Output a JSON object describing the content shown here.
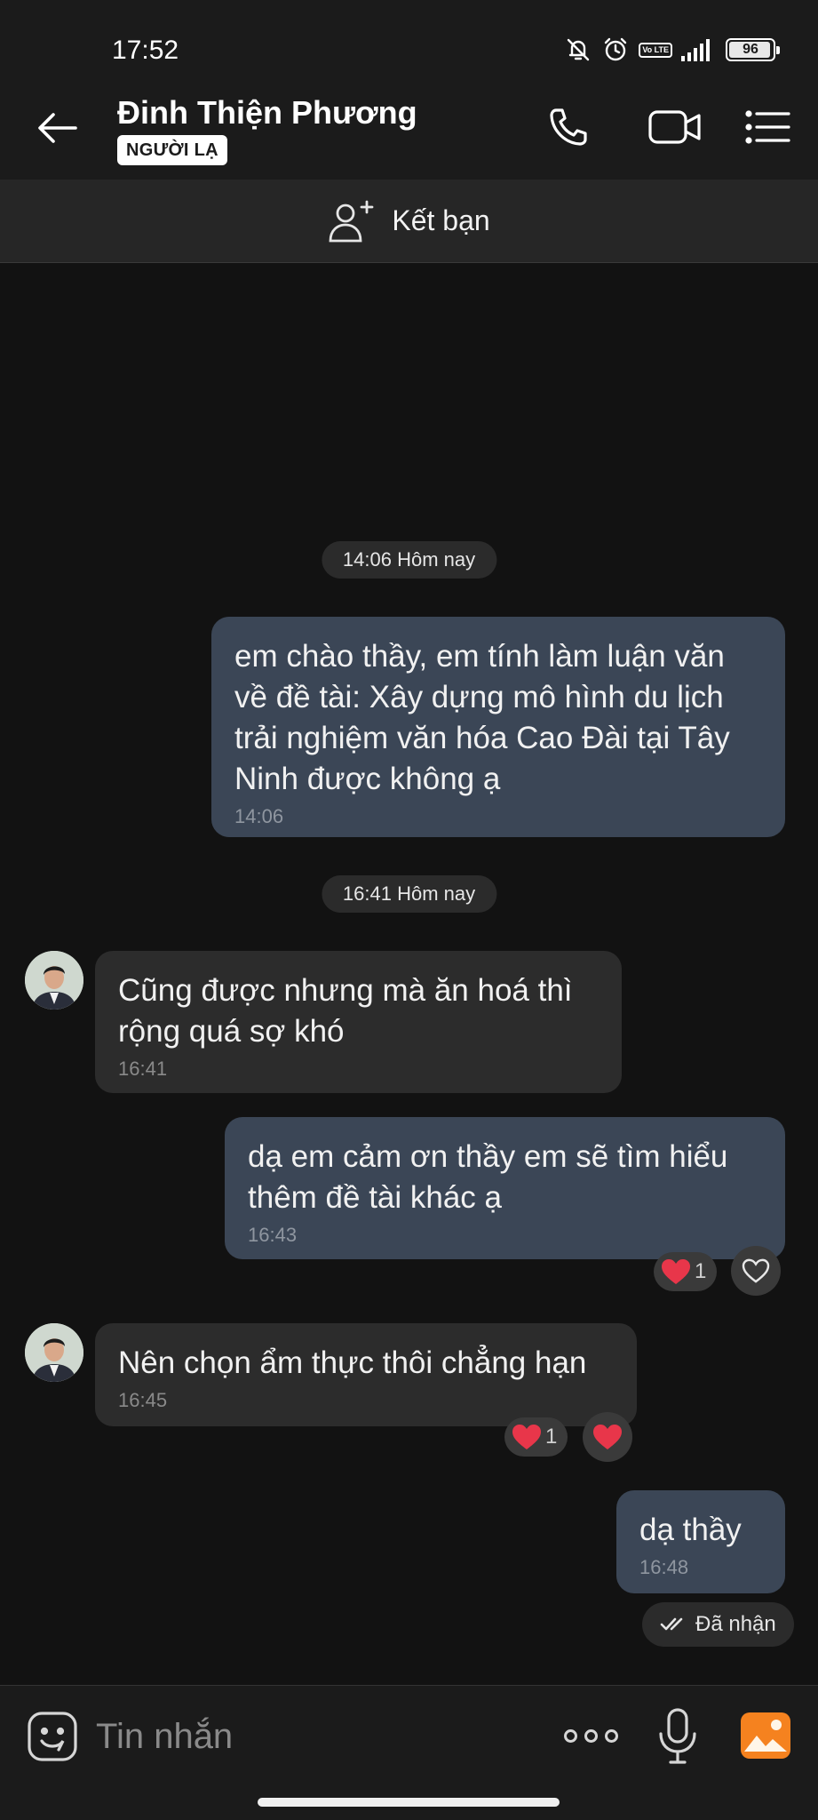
{
  "status_bar": {
    "time": "17:52",
    "battery": "96",
    "volte": "Vo\nLTE",
    "icons": [
      "bell-off-icon",
      "alarm-icon",
      "volte-icon",
      "signal-icon",
      "battery-icon"
    ]
  },
  "header": {
    "contact_name": "Đinh Thiện Phương",
    "badge": "NGƯỜI LẠ",
    "icons": [
      "back-arrow-icon",
      "phone-icon",
      "video-call-icon",
      "menu-icon"
    ]
  },
  "add_friend": {
    "label": "Kết bạn",
    "icon": "add-user-icon"
  },
  "chat": {
    "date_separators": [
      "14:06 Hôm nay",
      "16:41 Hôm nay"
    ],
    "messages": [
      {
        "direction": "out",
        "text": "em chào thầy, em tính làm luận văn\nvề đề tài: Xây dựng mô hình du lịch\ntrải nghiệm văn hóa Cao Đài tại Tây\nNinh được không ạ",
        "time": "14:06"
      },
      {
        "direction": "in",
        "text": "Cũng được nhưng mà ăn hoá thì\nrộng quá sợ khó",
        "time": "16:41"
      },
      {
        "direction": "out",
        "text": "dạ em cảm ơn thầy em sẽ tìm hiểu\nthêm đề tài khác ạ",
        "time": "16:43",
        "reaction_count": "1"
      },
      {
        "direction": "in",
        "text": "Nên chọn ẩm thực thôi chẳng hạn",
        "time": "16:45",
        "reaction_count": "1"
      },
      {
        "direction": "out",
        "text": "dạ thầy",
        "time": "16:48"
      }
    ],
    "received_status": "Đã nhận"
  },
  "input_bar": {
    "placeholder": "Tin nhắn",
    "icons": [
      "sticker-icon",
      "more-options-icon",
      "microphone-icon",
      "gallery-icon"
    ]
  },
  "colors": {
    "background": "#121212",
    "bar": "#1b1b1b",
    "outgoing_bubble": "#3b4656",
    "incoming_bubble": "#2c2c2c",
    "heart": "#e8364a",
    "gallery_accent": "#f5821f"
  }
}
